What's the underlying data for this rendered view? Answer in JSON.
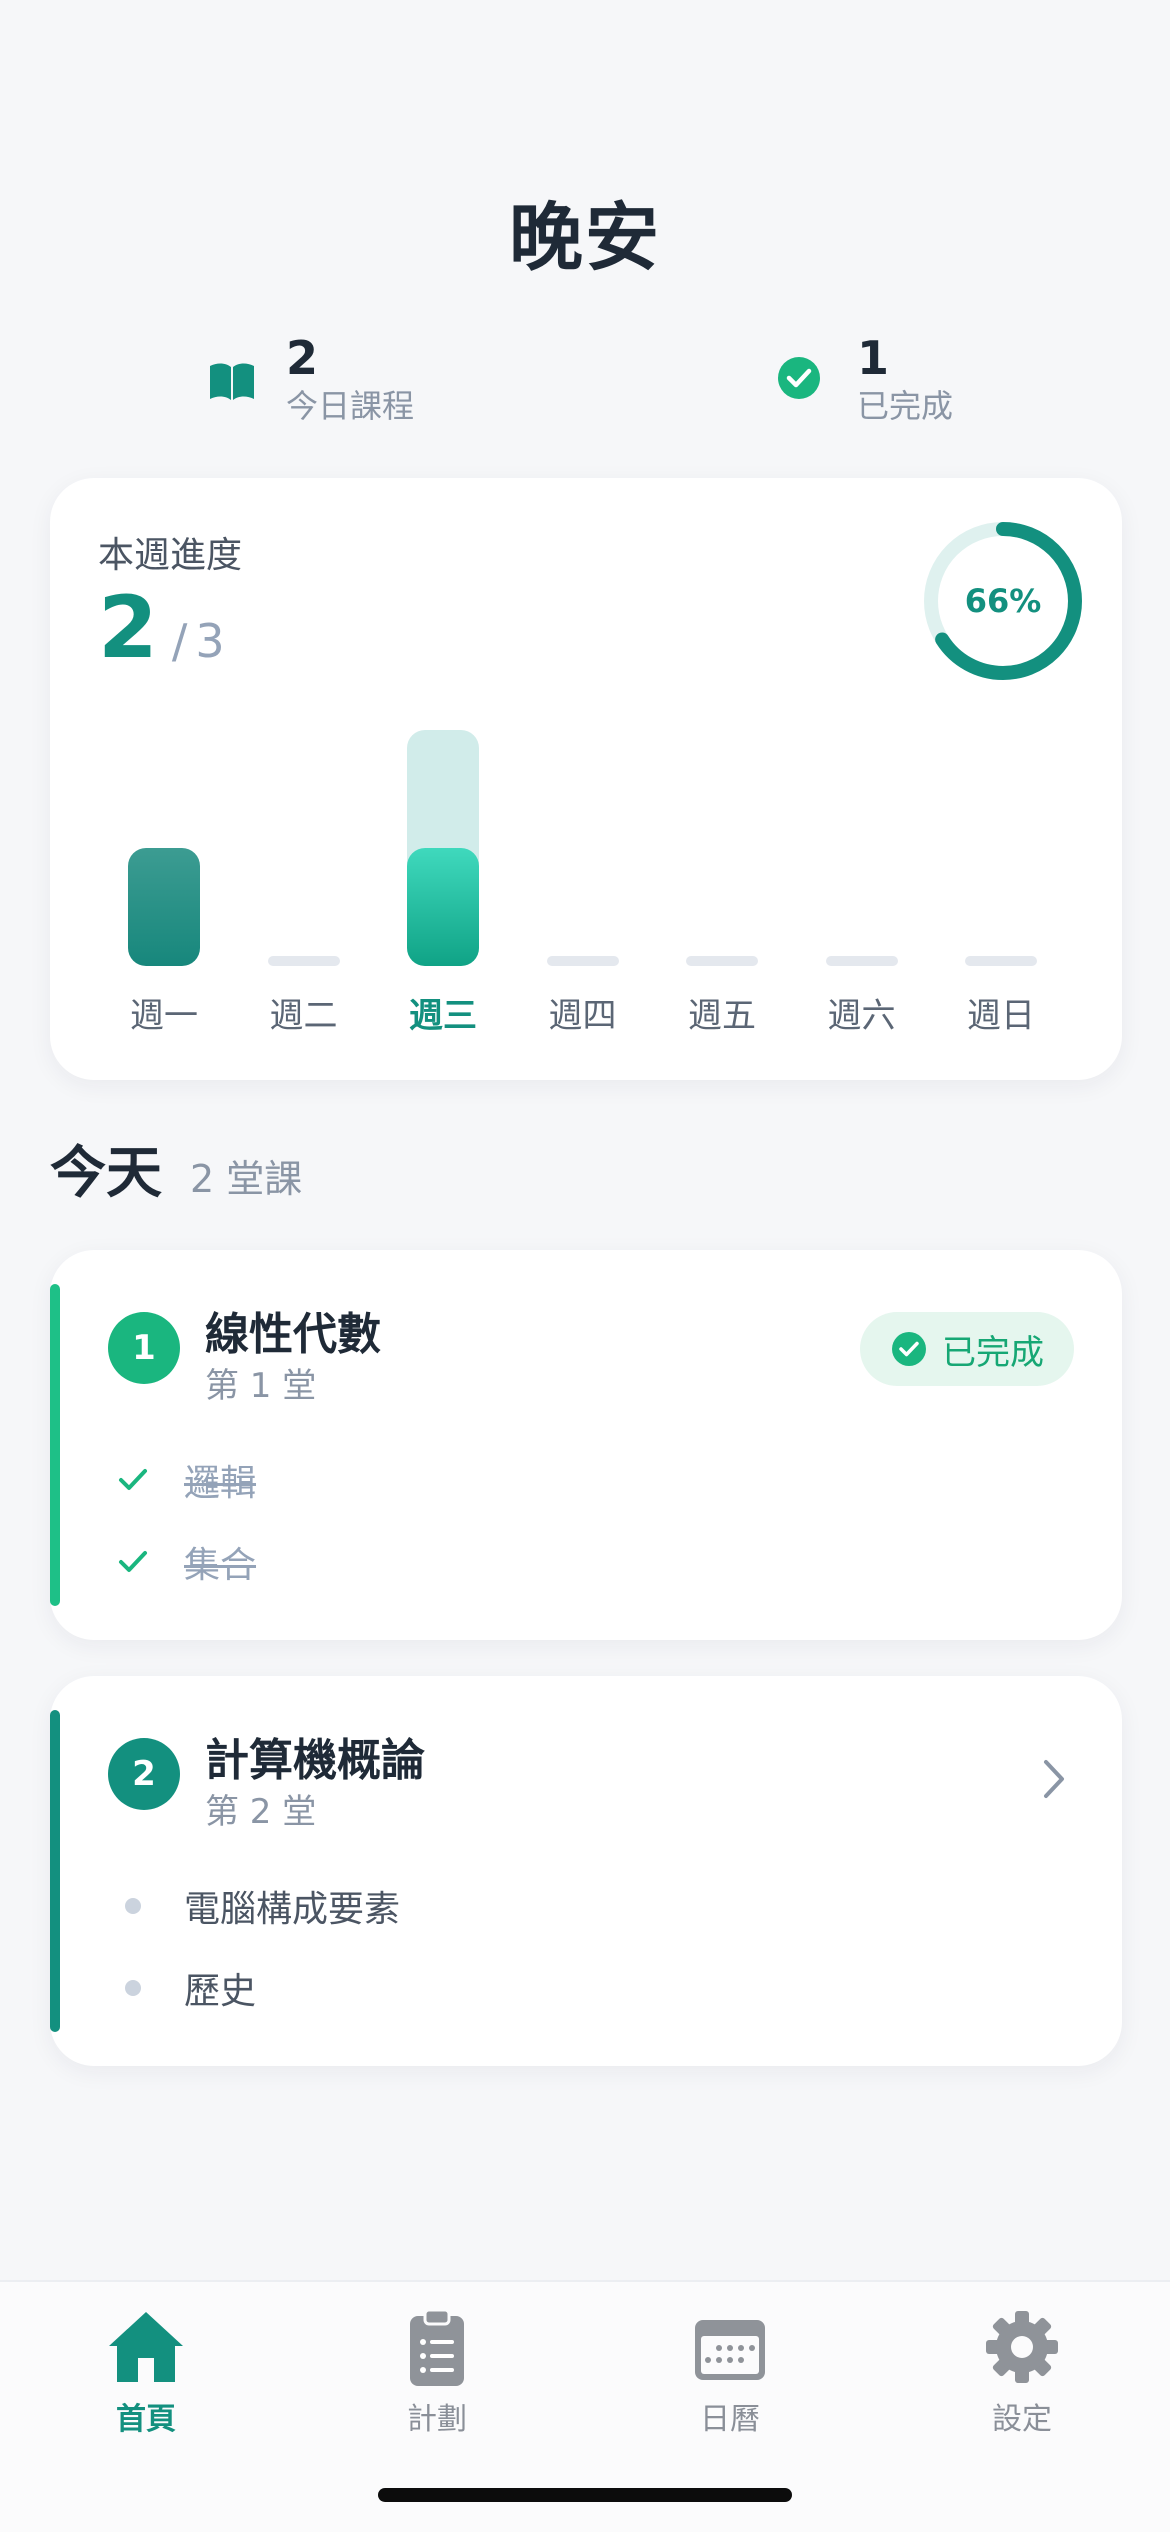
{
  "header": {
    "greeting": "晚安"
  },
  "stats": {
    "today_courses": {
      "value": "2",
      "label": "今日課程",
      "icon": "book-icon"
    },
    "completed": {
      "value": "1",
      "label": "已完成",
      "icon": "check-circle-icon"
    }
  },
  "weekly_progress": {
    "title": "本週進度",
    "done": "2",
    "separator": "/",
    "total": "3",
    "percent_label": "66%",
    "percent": 66,
    "days": [
      {
        "label": "週一",
        "scheduled": 1,
        "completed": 1,
        "active": false
      },
      {
        "label": "週二",
        "scheduled": 0,
        "completed": 0,
        "active": false
      },
      {
        "label": "週三",
        "scheduled": 2,
        "completed": 1,
        "active": true
      },
      {
        "label": "週四",
        "scheduled": 0,
        "completed": 0,
        "active": false
      },
      {
        "label": "週五",
        "scheduled": 0,
        "completed": 0,
        "active": false
      },
      {
        "label": "週六",
        "scheduled": 0,
        "completed": 0,
        "active": false
      },
      {
        "label": "週日",
        "scheduled": 0,
        "completed": 0,
        "active": false
      }
    ]
  },
  "today": {
    "title": "今天",
    "count_label": "2 堂課",
    "courses": [
      {
        "number": "1",
        "name": "線性代數",
        "session": "第 1 堂",
        "status": "已完成",
        "topics": [
          "邏輯",
          "集合"
        ],
        "completed": true
      },
      {
        "number": "2",
        "name": "計算機概論",
        "session": "第 2 堂",
        "topics": [
          "電腦構成要素",
          "歷史"
        ],
        "completed": false
      }
    ]
  },
  "tabbar": {
    "items": [
      {
        "label": "首頁",
        "icon": "home-icon",
        "active": true
      },
      {
        "label": "計劃",
        "icon": "clipboard-icon",
        "active": false
      },
      {
        "label": "日曆",
        "icon": "calendar-icon",
        "active": false
      },
      {
        "label": "設定",
        "icon": "gear-icon",
        "active": false
      }
    ]
  },
  "colors": {
    "accent": "#13907f",
    "success": "#1ab67f",
    "muted": "#8a95a5"
  }
}
